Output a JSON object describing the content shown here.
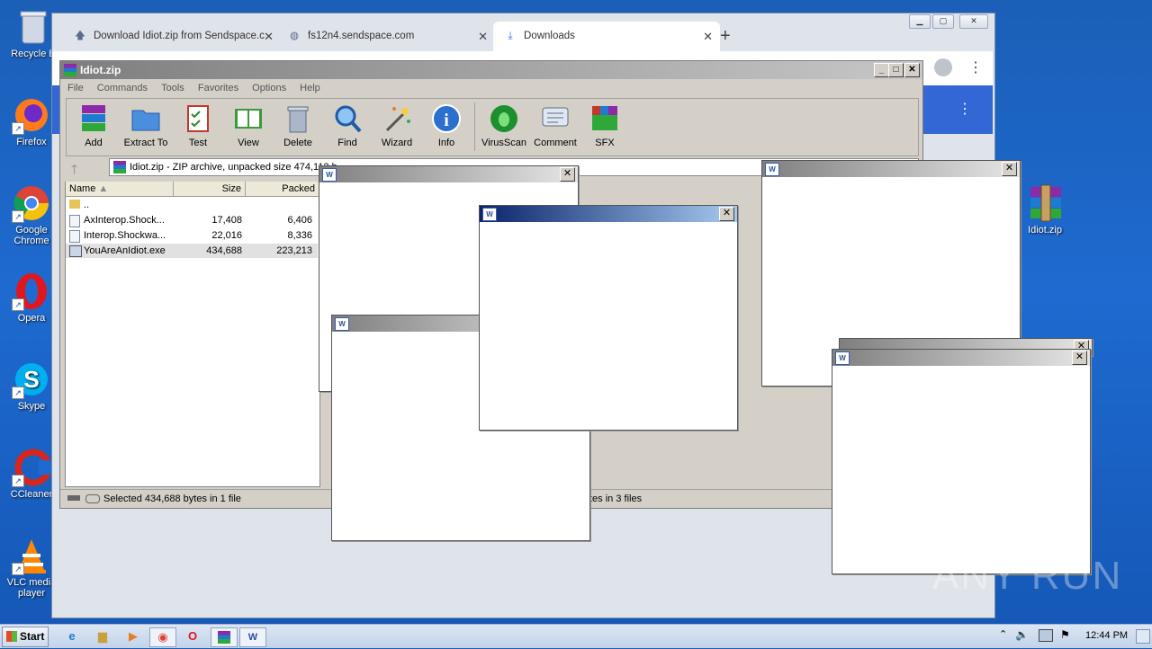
{
  "desktop": {
    "icons": [
      {
        "label": "Recycle B",
        "icon": "recycle-bin-icon"
      },
      {
        "label": "Firefox",
        "icon": "firefox-icon"
      },
      {
        "label": "Google Chrome",
        "icon": "chrome-icon"
      },
      {
        "label": "Opera",
        "icon": "opera-icon"
      },
      {
        "label": "Skype",
        "icon": "skype-icon"
      },
      {
        "label": "CCleaner",
        "icon": "ccleaner-icon"
      },
      {
        "label": "VLC media player",
        "icon": "vlc-icon"
      },
      {
        "label": "Idiot.zip",
        "icon": "winrar-archive-icon"
      }
    ]
  },
  "browser": {
    "tabs": [
      {
        "label": "Download Idiot.zip from Sendspace.c",
        "icon": "upload-arrow-icon"
      },
      {
        "label": "fs12n4.sendspace.com",
        "icon": "globe-icon"
      },
      {
        "label": "Downloads",
        "icon": "download-icon"
      }
    ],
    "new_tab": "+",
    "menu_dots": "⋮"
  },
  "winrar": {
    "title": "Idiot.zip",
    "menu": [
      "File",
      "Commands",
      "Tools",
      "Favorites",
      "Options",
      "Help"
    ],
    "toolbar": [
      "Add",
      "Extract To",
      "Test",
      "View",
      "Delete",
      "Find",
      "Wizard",
      "Info",
      "VirusScan",
      "Comment",
      "SFX"
    ],
    "path_text": "Idiot.zip - ZIP archive, unpacked size 474,112 b",
    "columns": [
      "Name",
      "Size",
      "Packed"
    ],
    "files": [
      {
        "name": "..",
        "size": "",
        "packed": ""
      },
      {
        "name": "AxInterop.Shock...",
        "size": "17,408",
        "packed": "6,406"
      },
      {
        "name": "Interop.Shockwa...",
        "size": "22,016",
        "packed": "8,336"
      },
      {
        "name": "YouAreAnIdiot.exe",
        "size": "434,688",
        "packed": "223,213"
      }
    ],
    "status_left": "Selected 434,688 bytes in 1 file",
    "status_right": "tes in 3 files"
  },
  "taskbar": {
    "start": "Start",
    "clock": "12:44 PM"
  },
  "watermark": "ANY RUN"
}
